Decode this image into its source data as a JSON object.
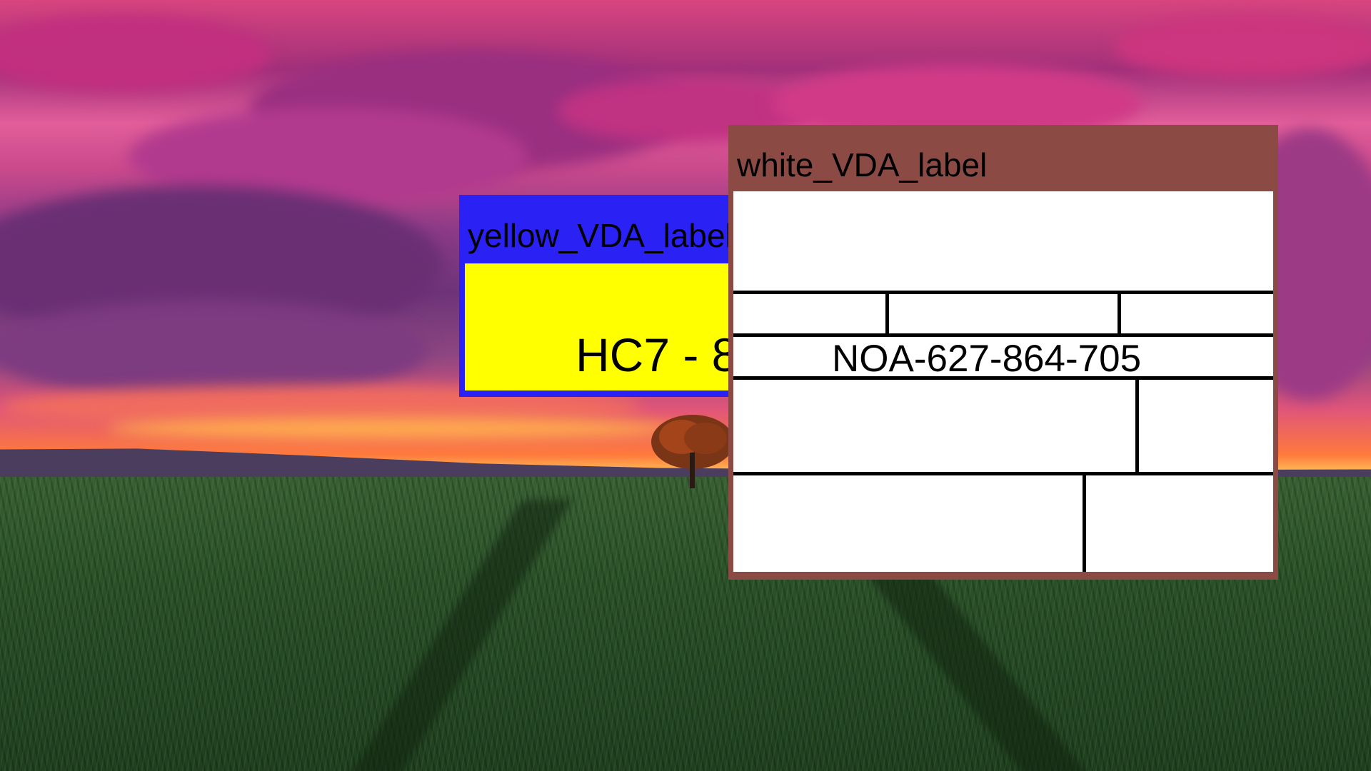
{
  "windows": {
    "yellow_label": {
      "title": "yellow_VDA_label",
      "code": "HC7 - 8",
      "titlebar_color": "#2a22f5",
      "body_color": "#ffff00"
    },
    "white_label": {
      "title": "white_VDA_label",
      "code": "NOA-627-864-705",
      "titlebar_color": "#8c4a45",
      "body_color": "#ffffff"
    }
  },
  "desktop": {
    "wallpaper": "sunset-field-wallpaper"
  }
}
